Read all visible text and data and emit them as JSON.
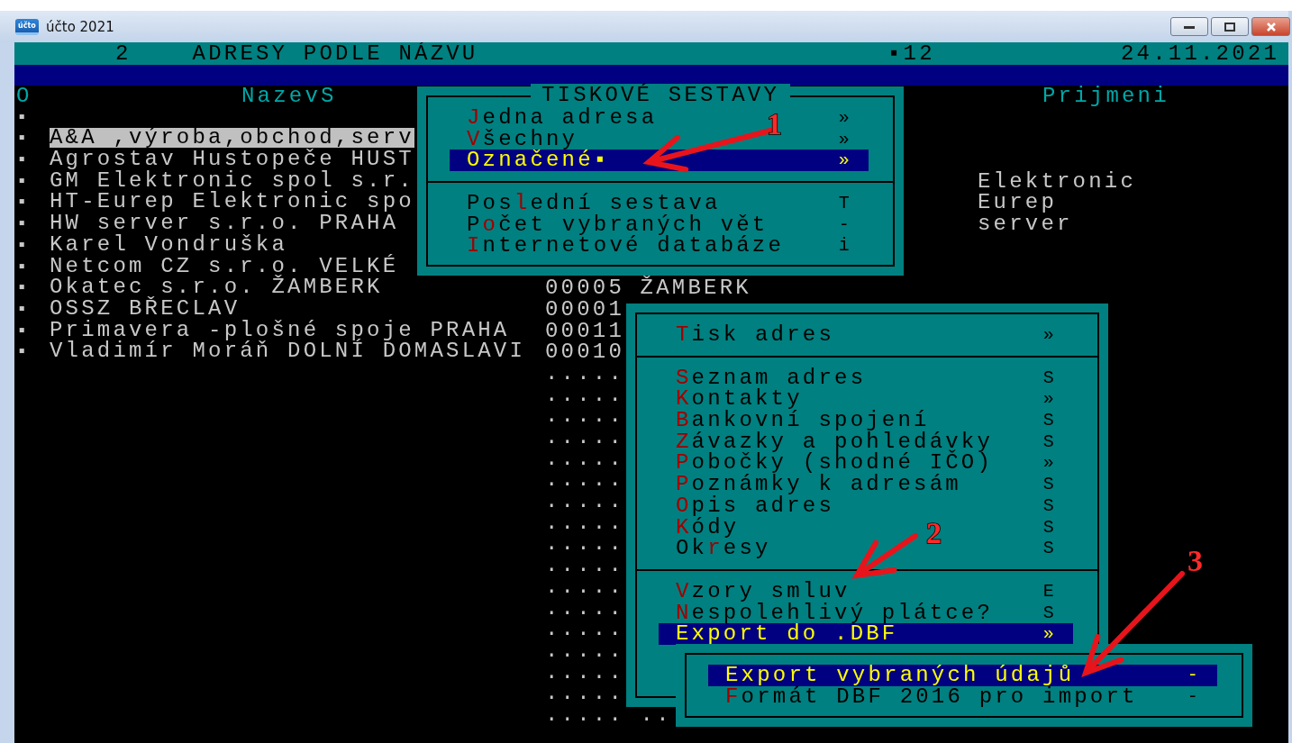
{
  "window": {
    "icon_text": "účto",
    "title": "účto 2021"
  },
  "header": {
    "number": "2",
    "title": "ADRESY PODLE NÁZVU",
    "count": "▪12",
    "date": "24.11.2021"
  },
  "columns": {
    "mark": "O",
    "name": "NazevS",
    "surname": "Prijmeni"
  },
  "rows": [
    {
      "mark": "▪",
      "selected": false
    },
    {
      "mark": "▪",
      "name": "A&A ,výroba,obchod,serv",
      "selected": true
    },
    {
      "mark": "▪",
      "name": "Agrostav Hustopeče HUST",
      "selected": false
    },
    {
      "mark": "▪",
      "name": "GM Elektronic spol s.r.",
      "surname": "Elektronic",
      "selected": false
    },
    {
      "mark": "▪",
      "name": "HT-Eurep Elektronic spo",
      "surname": "Eurep",
      "selected": false
    },
    {
      "mark": "▪",
      "name": "HW server s.r.o. PRAHA",
      "surname": "server",
      "selected": false
    },
    {
      "mark": "▪",
      "name": "Karel Vondruška",
      "selected": false
    },
    {
      "mark": "▪",
      "name": "Netcom CZ s.r.o. VELKÉ",
      "selected": false
    },
    {
      "mark": "▪",
      "name": "Okatec s.r.o. ŽAMBERK",
      "code": "00005 ŽAMBERK",
      "selected": false
    },
    {
      "mark": "▪",
      "name": "OSSZ BŘECLAV",
      "code": "00001",
      "selected": false
    },
    {
      "mark": "▪",
      "name": "Primavera -plošné spoje PRAHA",
      "code": "00011",
      "selected": false
    },
    {
      "mark": "▪",
      "name": "Vladimír Moráň DOLNÍ DOMASLAVI",
      "code": "00010",
      "selected": false
    }
  ],
  "filler_rows": [
    ".....",
    ".....",
    ".....",
    ".....",
    ".....",
    ".....",
    ".....",
    ".....",
    ".....",
    ".....",
    ".....",
    ".....",
    ".....",
    ".....",
    ".....",
    ".....",
    "..... .."
  ],
  "menus": [
    {
      "title": "TISKOVÉ SESTAVY",
      "sections": [
        [
          {
            "key": "J",
            "rest": "edna adresa",
            "shortcut": "»",
            "selected": false
          },
          {
            "key": "V",
            "rest": "šechny",
            "shortcut": "»",
            "selected": false
          },
          {
            "key": "O",
            "rest": "značené▪",
            "shortcut": "»",
            "selected": true
          }
        ],
        [
          {
            "lead": "Pos",
            "key": "l",
            "rest": "ední sestava",
            "shortcut": "T",
            "selected": false
          },
          {
            "lead": "P",
            "key": "o",
            "rest": "čet vybraných vět",
            "shortcut": "-",
            "selected": false
          },
          {
            "key": "I",
            "rest": "nternetové databáze",
            "shortcut": "i",
            "selected": false
          }
        ]
      ]
    },
    {
      "sections": [
        [
          {
            "key": "T",
            "rest": "isk adres",
            "shortcut": "»",
            "selected": false
          }
        ],
        [
          {
            "key": "S",
            "rest": "eznam adres",
            "shortcut": "S",
            "selected": false
          },
          {
            "key": "K",
            "rest": "ontakty",
            "shortcut": "»",
            "selected": false
          },
          {
            "key": "B",
            "rest": "ankovní spojení",
            "shortcut": "S",
            "selected": false
          },
          {
            "key": "Z",
            "rest": "ávazky a pohledávky",
            "shortcut": "S",
            "selected": false
          },
          {
            "key": "P",
            "rest": "obočky (shodné IČO)",
            "shortcut": "»",
            "selected": false
          },
          {
            "key": "P",
            "rest": "oznámky k adresám",
            "shortcut": "S",
            "selected": false
          },
          {
            "key": "O",
            "rest": "pis adres",
            "shortcut": "S",
            "selected": false
          },
          {
            "key": "K",
            "rest": "ódy",
            "shortcut": "S",
            "selected": false
          },
          {
            "lead": "Ok",
            "key": "r",
            "rest": "esy",
            "shortcut": "S",
            "selected": false
          }
        ],
        [
          {
            "key": "V",
            "rest": "zory smluv",
            "shortcut": "E",
            "selected": false
          },
          {
            "key": "N",
            "rest": "espolehlivý plátce?",
            "shortcut": "S",
            "selected": false
          },
          {
            "key": "E",
            "rest": "xport do .DBF",
            "shortcut": "»",
            "selected": true
          }
        ]
      ]
    },
    {
      "sections": [
        [
          {
            "key": "E",
            "rest": "xport vybraných údajů",
            "shortcut": "-",
            "selected": true
          },
          {
            "key": "F",
            "rest": "ormát DBF 2016 pro import",
            "shortcut": "-",
            "selected": false
          }
        ]
      ]
    }
  ],
  "annotations": [
    {
      "label": "1"
    },
    {
      "label": "2"
    },
    {
      "label": "3"
    }
  ]
}
